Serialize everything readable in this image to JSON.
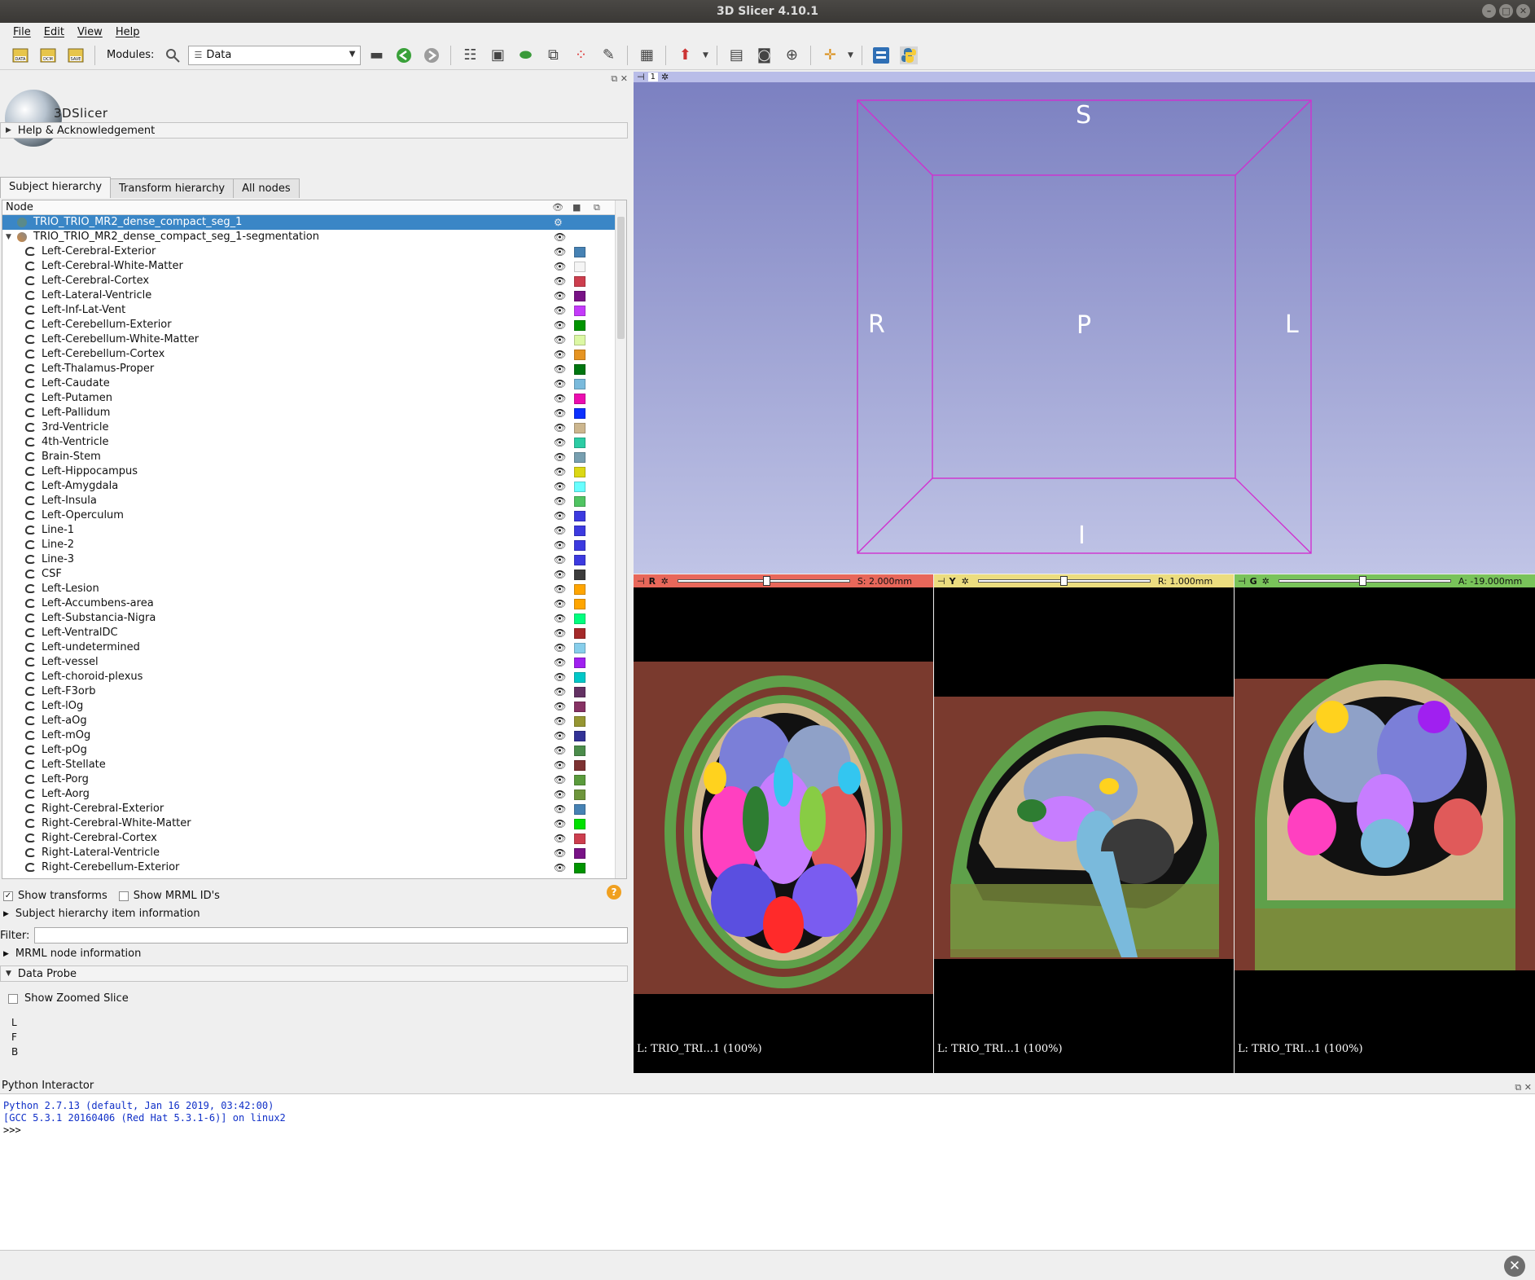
{
  "window": {
    "title": "3D Slicer 4.10.1"
  },
  "menu": {
    "file": "File",
    "edit": "Edit",
    "view": "View",
    "help": "Help"
  },
  "toolbar": {
    "modules_label": "Modules:",
    "module_selected": "Data"
  },
  "logo_text": "3DSlicer",
  "sections": {
    "help": "Help & Acknowledgement",
    "sh_info": "Subject hierarchy item information",
    "mrml_info": "MRML node information",
    "data_probe": "Data Probe"
  },
  "tabs": [
    "Subject hierarchy",
    "Transform hierarchy",
    "All nodes"
  ],
  "tree": {
    "header": "Node",
    "root": "TRIO_TRIO_MR2_dense_compact_seg_1",
    "segmentation": "TRIO_TRIO_MR2_dense_compact_seg_1-segmentation",
    "segments": [
      {
        "name": "Left-Cerebral-Exterior",
        "color": "#4682b4"
      },
      {
        "name": "Left-Cerebral-White-Matter",
        "color": "#f5f5f5"
      },
      {
        "name": "Left-Cerebral-Cortex",
        "color": "#cd3e4e"
      },
      {
        "name": "Left-Lateral-Ventricle",
        "color": "#781286"
      },
      {
        "name": "Left-Inf-Lat-Vent",
        "color": "#c43afa"
      },
      {
        "name": "Left-Cerebellum-Exterior",
        "color": "#009400"
      },
      {
        "name": "Left-Cerebellum-White-Matter",
        "color": "#dcf8a4"
      },
      {
        "name": "Left-Cerebellum-Cortex",
        "color": "#e69422"
      },
      {
        "name": "Left-Thalamus-Proper",
        "color": "#007610"
      },
      {
        "name": "Left-Caudate",
        "color": "#7abadc"
      },
      {
        "name": "Left-Putamen",
        "color": "#ec0db0"
      },
      {
        "name": "Left-Pallidum",
        "color": "#0c30ff"
      },
      {
        "name": "3rd-Ventricle",
        "color": "#ccb68e"
      },
      {
        "name": "4th-Ventricle",
        "color": "#2ccca4"
      },
      {
        "name": "Brain-Stem",
        "color": "#779fb0"
      },
      {
        "name": "Left-Hippocampus",
        "color": "#dcd814"
      },
      {
        "name": "Left-Amygdala",
        "color": "#67ffff"
      },
      {
        "name": "Left-Insula",
        "color": "#50c462"
      },
      {
        "name": "Left-Operculum",
        "color": "#3c3ae0"
      },
      {
        "name": "Line-1",
        "color": "#3c3ae0"
      },
      {
        "name": "Line-2",
        "color": "#3c3ae0"
      },
      {
        "name": "Line-3",
        "color": "#3c3ae0"
      },
      {
        "name": "CSF",
        "color": "#3c3c3c"
      },
      {
        "name": "Left-Lesion",
        "color": "#ffa500"
      },
      {
        "name": "Left-Accumbens-area",
        "color": "#ffa500"
      },
      {
        "name": "Left-Substancia-Nigra",
        "color": "#00ff7f"
      },
      {
        "name": "Left-VentralDC",
        "color": "#a52a2a"
      },
      {
        "name": "Left-undetermined",
        "color": "#87ceeb"
      },
      {
        "name": "Left-vessel",
        "color": "#a020f0"
      },
      {
        "name": "Left-choroid-plexus",
        "color": "#00c8c8"
      },
      {
        "name": "Left-F3orb",
        "color": "#643264"
      },
      {
        "name": "Left-lOg",
        "color": "#873264"
      },
      {
        "name": "Left-aOg",
        "color": "#969632"
      },
      {
        "name": "Left-mOg",
        "color": "#323296"
      },
      {
        "name": "Left-pOg",
        "color": "#4b8c4b"
      },
      {
        "name": "Left-Stellate",
        "color": "#7d3232"
      },
      {
        "name": "Left-Porg",
        "color": "#5a9b3c"
      },
      {
        "name": "Left-Aorg",
        "color": "#6e963c"
      },
      {
        "name": "Right-Cerebral-Exterior",
        "color": "#4682b4"
      },
      {
        "name": "Right-Cerebral-White-Matter",
        "color": "#00e100"
      },
      {
        "name": "Right-Cerebral-Cortex",
        "color": "#cd3e4e"
      },
      {
        "name": "Right-Lateral-Ventricle",
        "color": "#781286"
      },
      {
        "name": "Right-Cerebellum-Exterior",
        "color": "#009400"
      }
    ]
  },
  "options": {
    "show_transforms": "Show transforms",
    "show_mrml_ids": "Show MRML ID's",
    "show_zoomed": "Show Zoomed Slice"
  },
  "filter_label": "Filter:",
  "probe_lines": [
    "L",
    "F",
    "B"
  ],
  "view3d": {
    "number": "1",
    "S": "S",
    "R": "R",
    "P": "P",
    "L": "L",
    "I": "I"
  },
  "slices": [
    {
      "letter": "R",
      "offset": "S: 2.000mm",
      "bar_color": "#e8675a",
      "corner": "L: TRIO_TRI...1 (100%)"
    },
    {
      "letter": "Y",
      "offset": "R: 1.000mm",
      "bar_color": "#ecdd7f",
      "corner": "L: TRIO_TRI...1 (100%)"
    },
    {
      "letter": "G",
      "offset": "A: -19.000mm",
      "bar_color": "#79c35a",
      "corner": "L: TRIO_TRI...1 (100%)"
    }
  ],
  "python": {
    "title": "Python Interactor",
    "line1": "Python 2.7.13 (default, Jan 16 2019, 03:42:00)",
    "line2": "[GCC 5.3.1 20160406 (Red Hat 5.3.1-6)] on linux2",
    "prompt": ">>>"
  }
}
